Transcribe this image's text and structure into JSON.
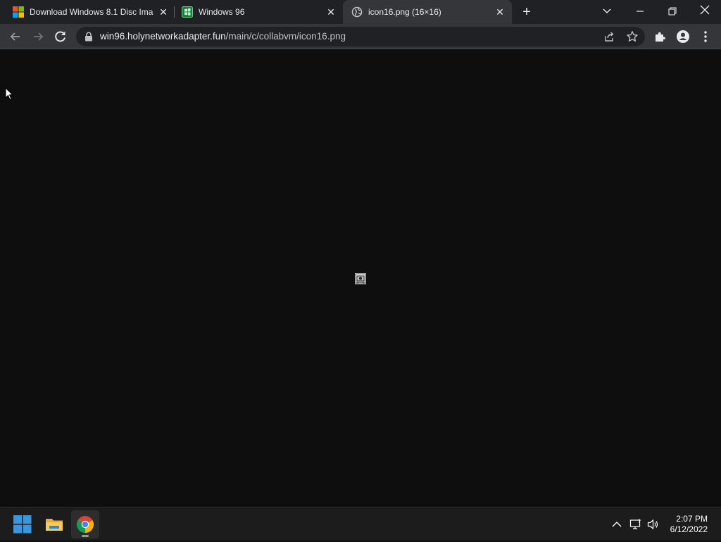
{
  "browser": {
    "tabs": [
      {
        "title": "Download Windows 8.1 Disc Ima",
        "icon": "microsoft-logo-icon",
        "active": false
      },
      {
        "title": "Windows 96",
        "icon": "windows96-icon",
        "active": false
      },
      {
        "title": "icon16.png (16×16)",
        "icon": "globe-icon",
        "active": true
      }
    ],
    "new_tab_label": "+",
    "address": {
      "host": "win96.holynetworkadapter.fun",
      "path": "/main/c/collabvm/icon16.png"
    }
  },
  "content": {
    "image_alt": "icon16.png"
  },
  "taskbar": {
    "apps": [
      "start-icon",
      "file-explorer-icon",
      "chrome-icon"
    ],
    "time": "2:07 PM",
    "date": "6/12/2022"
  },
  "colors": {
    "tab_strip": "#202124",
    "toolbar": "#35363a",
    "page_background": "#0e0e0e",
    "taskbar": "#1c1c1c",
    "accent_blue": "#3a96dd"
  }
}
